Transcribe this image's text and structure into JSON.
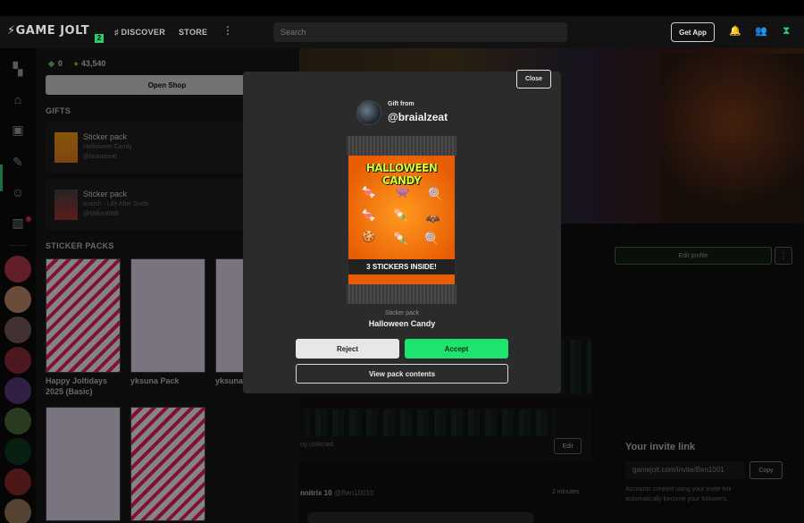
{
  "nav": {
    "logo": "GAME JOLT",
    "logo_badge": "2",
    "discover": "DISCOVER",
    "store": "STORE",
    "more": "⋮",
    "search_placeholder": "Search",
    "get_app": "Get App"
  },
  "shop": {
    "gems": "0",
    "coins": "43,540",
    "open_shop": "Open Shop",
    "gifts_title": "GIFTS",
    "gifts": [
      {
        "name": "Sticker pack",
        "subtitle": "Halloween Candy",
        "from": "@braialzeat"
      },
      {
        "name": "Sticker pack",
        "subtitle": "Imaish - Life After Gods",
        "from": "@MilkerBBB"
      }
    ],
    "sticker_packs_title": "STICKER PACKS",
    "sticker_packs": [
      {
        "label": "Happy Joltidays 2025 (Basic)"
      },
      {
        "label": "yksuna Pack"
      },
      {
        "label": "yksuna"
      }
    ]
  },
  "profile": {
    "edit_profile": "Edit profile",
    "more": "⋮",
    "collected_text": "ng collected",
    "edit": "Edit",
    "author": "nnitrix 10",
    "author_handle": "@Ben10010",
    "time": "2 minutes",
    "invite_title": "Your invite link",
    "invite_url": "gamejolt.com/invite/Ben1001",
    "copy": "Copy",
    "invite_note": "Accounts created using your invite link automatically become your followers."
  },
  "modal": {
    "close": "Close",
    "gift_from_label": "Gift from",
    "sender": "@braialzeat",
    "pack_art_title": "HALLOWEEN CANDY",
    "pack_art_banner": "3 STICKERS INSIDE!",
    "pack_type": "Sticker pack",
    "pack_name": "Halloween Candy",
    "reject": "Reject",
    "accept": "Accept",
    "view_contents": "View pack contents"
  },
  "colors": {
    "accent_green": "#1ce46c",
    "modal_bg": "#2b2b2b",
    "pack_orange": "#e85d04",
    "pack_title_lime": "#c7ff3a"
  }
}
